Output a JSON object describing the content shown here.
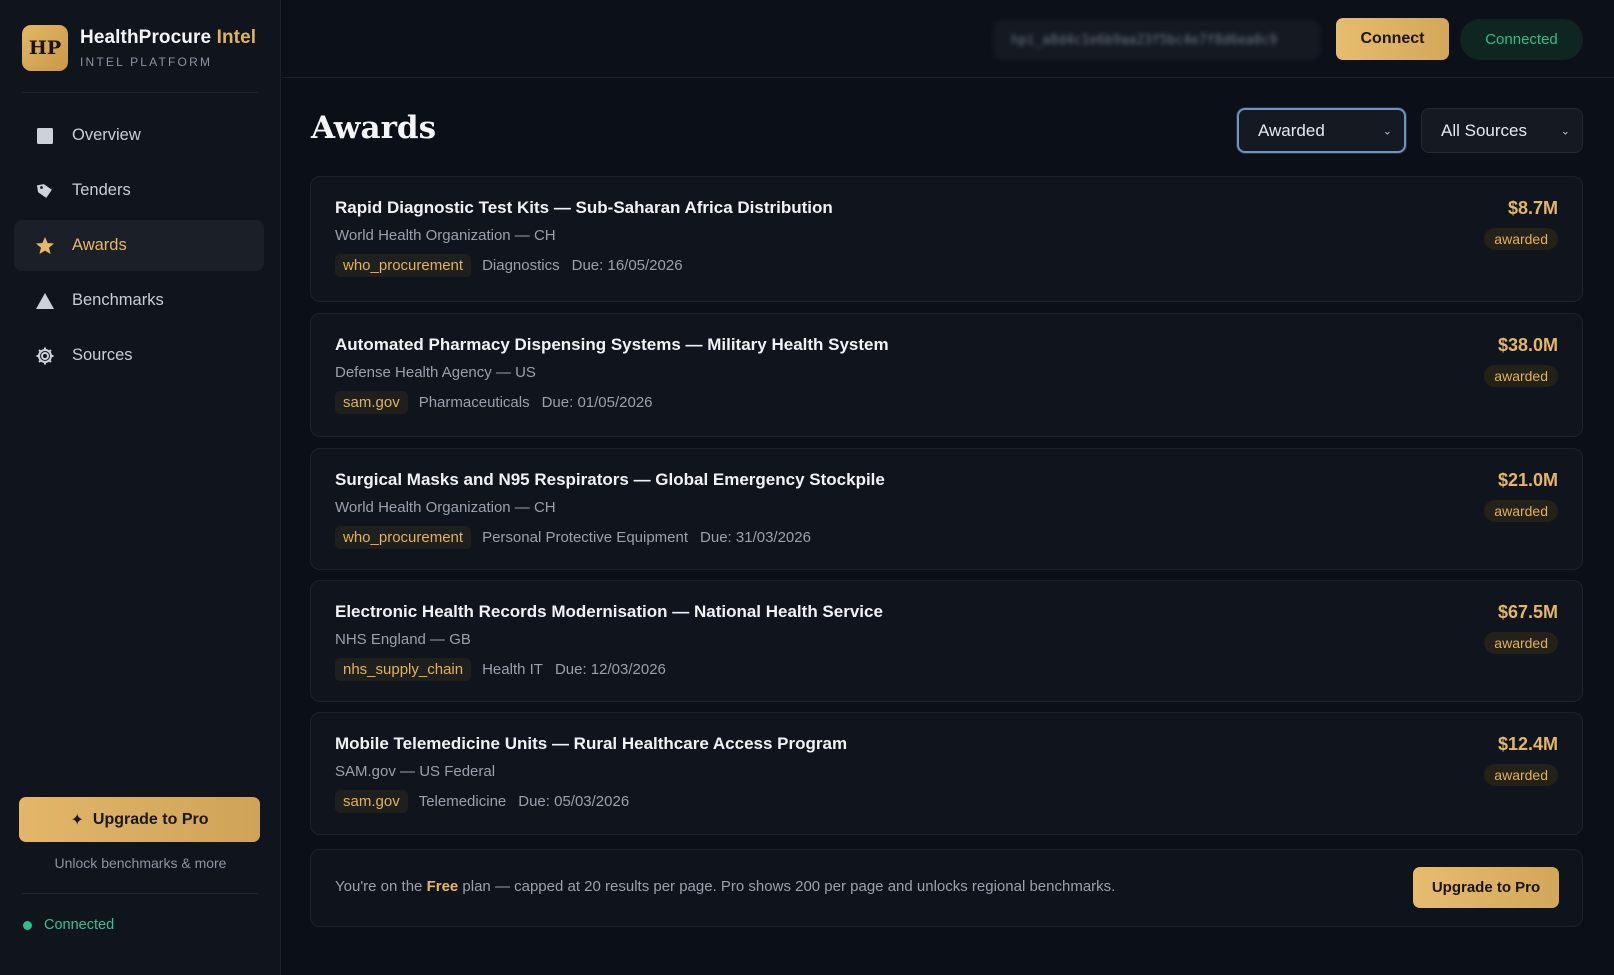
{
  "brand": {
    "logo": "HP",
    "name": "HealthProcure",
    "name_accent": "Intel",
    "subtitle": "INTEL PLATFORM"
  },
  "sidebar": {
    "items": [
      {
        "label": "Overview",
        "icon": "square-icon"
      },
      {
        "label": "Tenders",
        "icon": "tag-icon"
      },
      {
        "label": "Awards",
        "icon": "star-icon",
        "active": true
      },
      {
        "label": "Benchmarks",
        "icon": "triangle-icon"
      },
      {
        "label": "Sources",
        "icon": "gear-icon"
      }
    ],
    "upgrade_label": "Upgrade to Pro",
    "unlock_text": "Unlock benchmarks & more",
    "status": "Connected"
  },
  "header": {
    "token": "hpi_a8d4c1e6b9aa23f5bc4e7f8d6ea0c9",
    "connect_label": "Connect",
    "connected_label": "Connected"
  },
  "main": {
    "title": "Awards",
    "filter_status": "Awarded",
    "filter_source": "All Sources"
  },
  "awards": [
    {
      "title": "Rapid Diagnostic Test Kits — Sub-Saharan Africa Distribution",
      "org": "World Health Organization — CH",
      "source": "who_procurement",
      "category": "Diagnostics",
      "due": "Due: 16/05/2026",
      "amount": "$8.7M",
      "status": "awarded"
    },
    {
      "title": "Automated Pharmacy Dispensing Systems — Military Health System",
      "org": "Defense Health Agency — US",
      "source": "sam.gov",
      "category": "Pharmaceuticals",
      "due": "Due: 01/05/2026",
      "amount": "$38.0M",
      "status": "awarded"
    },
    {
      "title": "Surgical Masks and N95 Respirators — Global Emergency Stockpile",
      "org": "World Health Organization — CH",
      "source": "who_procurement",
      "category": "Personal Protective Equipment",
      "due": "Due: 31/03/2026",
      "amount": "$21.0M",
      "status": "awarded"
    },
    {
      "title": "Electronic Health Records Modernisation — National Health Service",
      "org": "NHS England — GB",
      "source": "nhs_supply_chain",
      "category": "Health IT",
      "due": "Due: 12/03/2026",
      "amount": "$67.5M",
      "status": "awarded"
    },
    {
      "title": "Mobile Telemedicine Units — Rural Healthcare Access Program",
      "org": "SAM.gov — US Federal",
      "source": "sam.gov",
      "category": "Telemedicine",
      "due": "Due: 05/03/2026",
      "amount": "$12.4M",
      "status": "awarded"
    }
  ],
  "plan": {
    "prefix": "You're on the ",
    "plan_name": "Free",
    "suffix": " plan — capped at 20 results per page. Pro shows 200 per page and unlocks regional benchmarks.",
    "upgrade_label": "Upgrade to Pro"
  },
  "colors": {
    "accent": "#e0b25e",
    "success": "#2fbf86",
    "background": "#0b0f17"
  }
}
